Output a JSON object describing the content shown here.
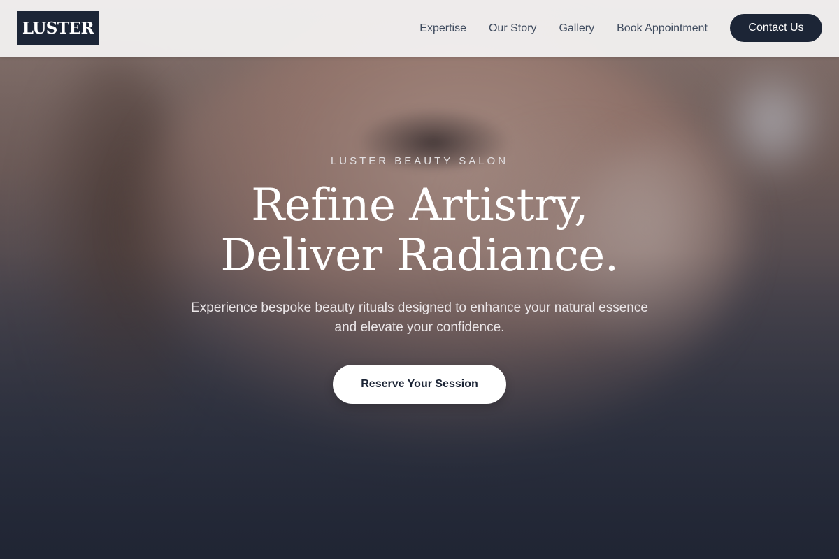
{
  "brand": {
    "logo_text": "LUSTER"
  },
  "nav": {
    "links": [
      "Expertise",
      "Our Story",
      "Gallery",
      "Book Appointment"
    ],
    "contact_label": "Contact Us"
  },
  "hero": {
    "eyebrow": "LUSTER BEAUTY SALON",
    "headline_line1": "Refine Artistry,",
    "headline_line2": "Deliver Radiance.",
    "subtitle": "Experience bespoke beauty rituals designed to enhance your natural essence and elevate your confidence.",
    "cta_label": "Reserve Your Session"
  },
  "colors": {
    "navy": "#1c2536",
    "nav_bg": "#f5f4f4",
    "cta_bg": "#ffffff",
    "nav_text": "#3f4b5e"
  }
}
